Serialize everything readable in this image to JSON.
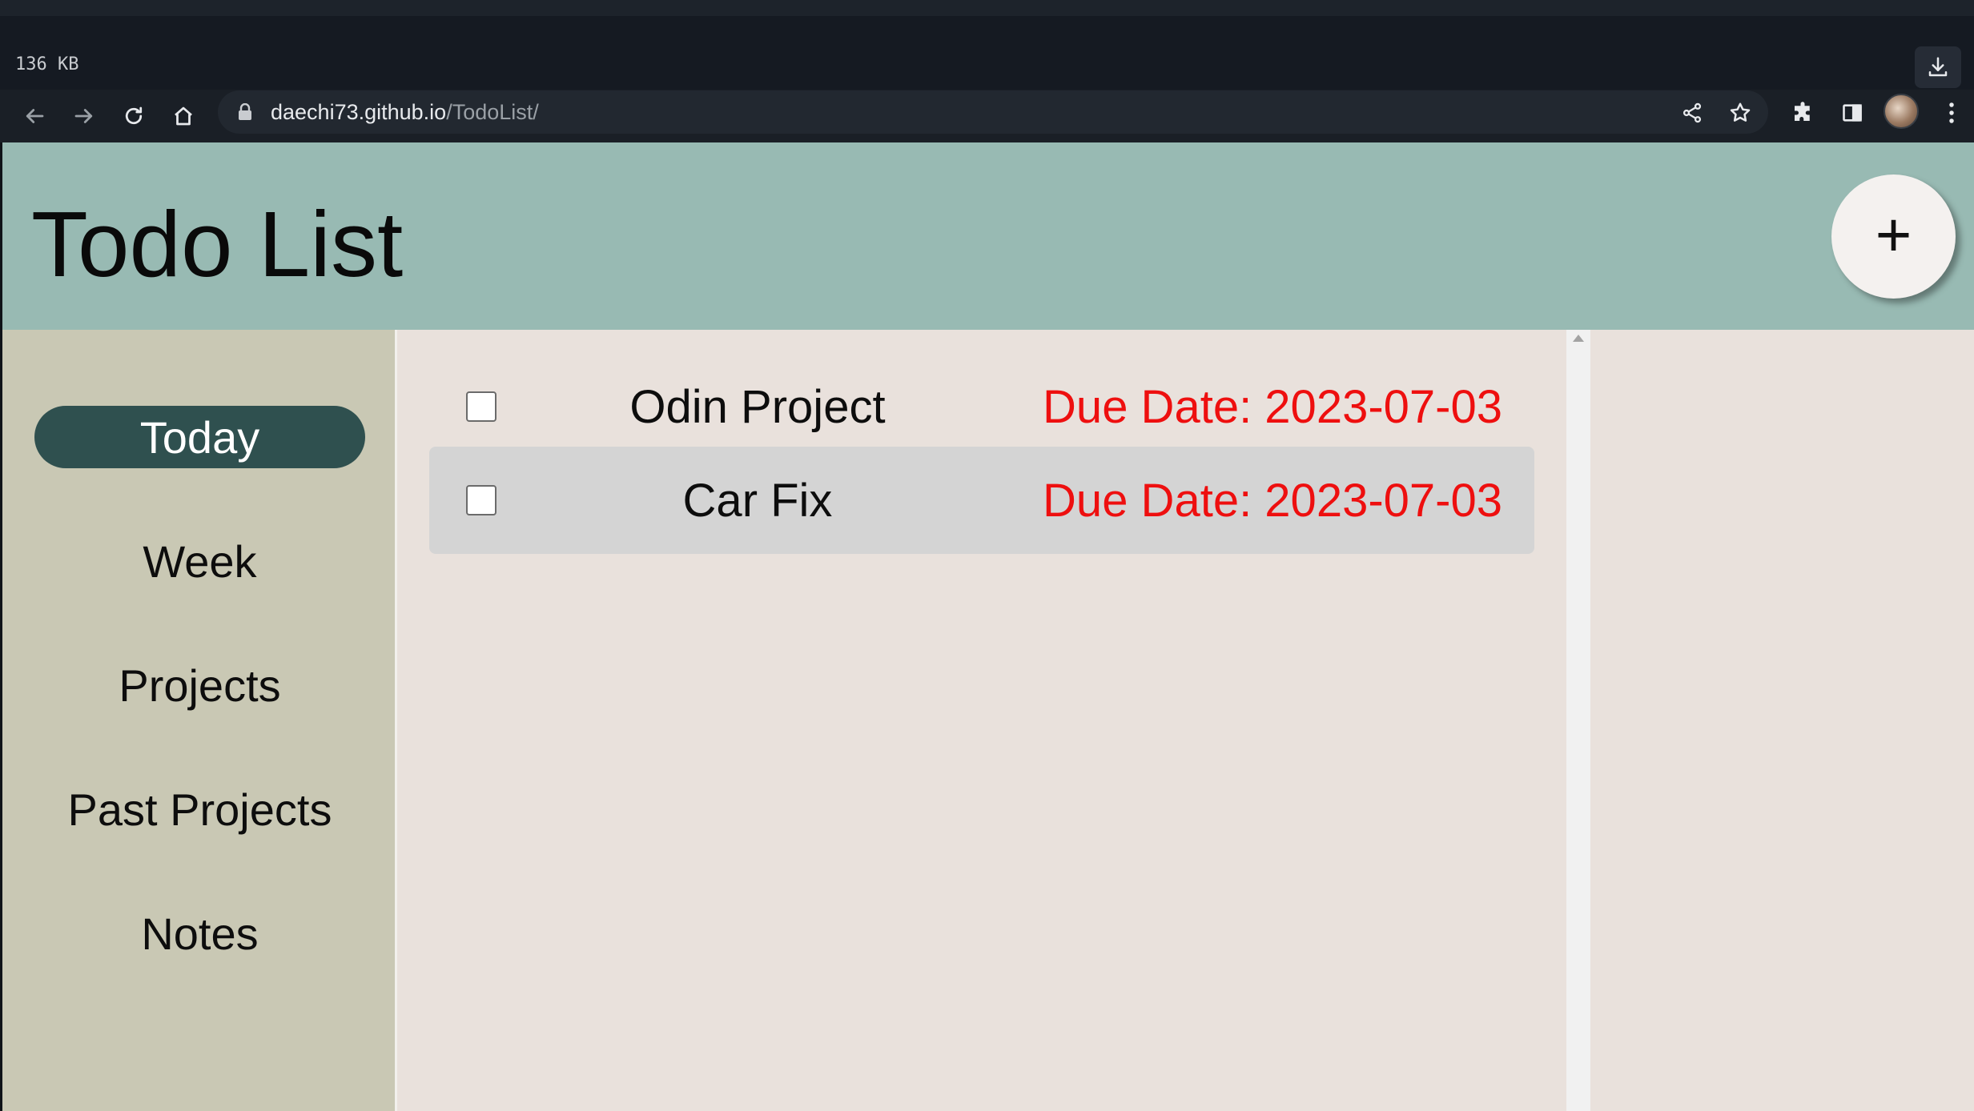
{
  "browser": {
    "download_size": "136 KB",
    "url_domain": "daechi73.github.io",
    "url_path": "/TodoList/",
    "icons": [
      "back-icon",
      "forward-icon",
      "reload-icon",
      "home-icon",
      "lock-icon",
      "share-icon",
      "star-icon",
      "extensions-icon",
      "side-panel-icon",
      "menu-icon",
      "download-icon"
    ]
  },
  "app": {
    "title": "Todo List",
    "add_button_label": "+"
  },
  "sidebar": {
    "items": [
      {
        "label": "Today",
        "active": true
      },
      {
        "label": "Week",
        "active": false
      },
      {
        "label": "Projects",
        "active": false
      },
      {
        "label": "Past Projects",
        "active": false
      },
      {
        "label": "Notes",
        "active": false
      }
    ]
  },
  "tasks": [
    {
      "name": "Odin Project",
      "due": "Due Date: 2023-07-03",
      "checked": false
    },
    {
      "name": "Car Fix",
      "due": "Due Date: 2023-07-03",
      "checked": false
    }
  ],
  "colors": {
    "header": "#98bab3",
    "sidebar": "#c9c8b4",
    "active_nav": "#2f504f",
    "content": "#e9e1dc",
    "due_date": "#ee0f0f"
  }
}
